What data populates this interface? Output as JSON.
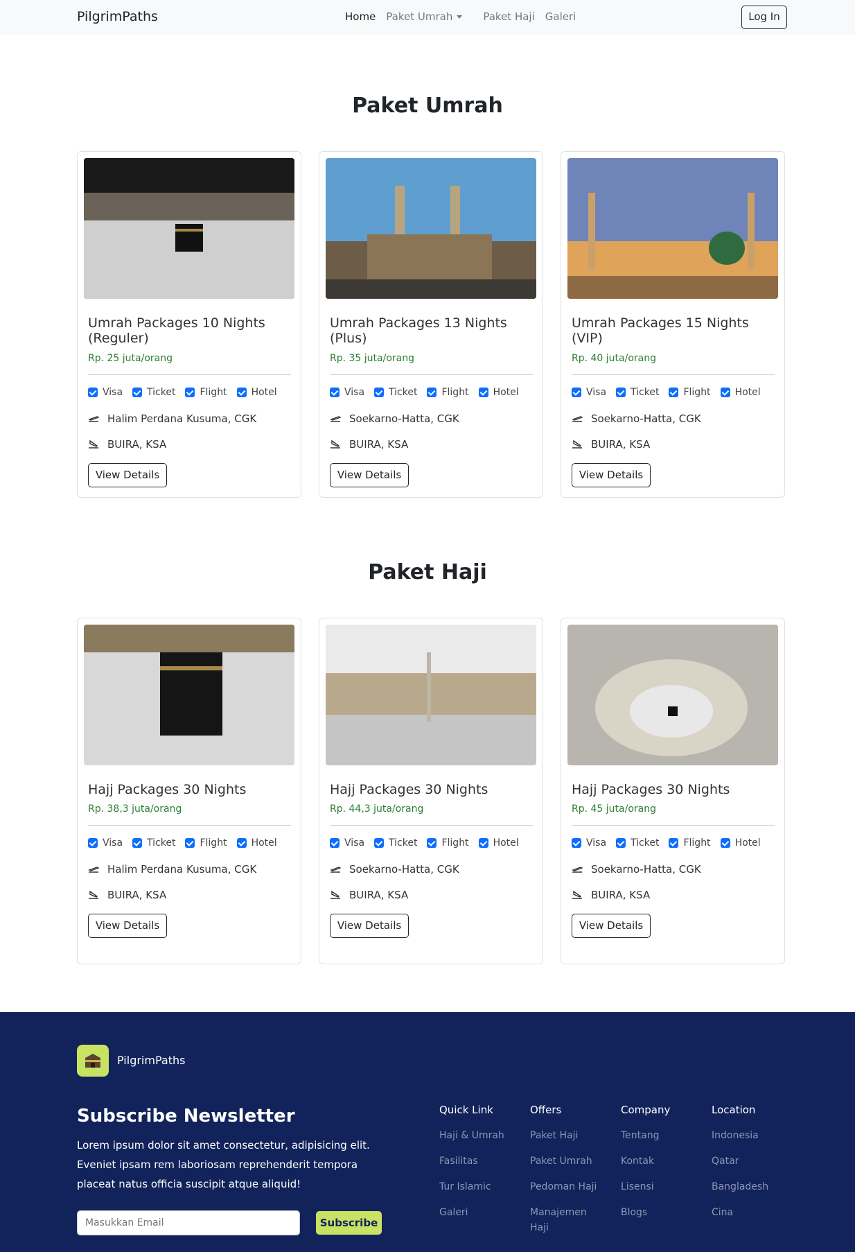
{
  "navbar": {
    "brand": "PilgrimPaths",
    "links": [
      "Home",
      "Paket Umrah",
      "Paket Haji",
      "Galeri"
    ],
    "login": "Log In"
  },
  "umrah": {
    "title": "Paket Umrah",
    "cards": [
      {
        "title": "Umrah Packages 10 Nights (Reguler)",
        "price": "Rp. 25 juta/orang",
        "features": [
          "Visa",
          "Ticket",
          "Flight",
          "Hotel"
        ],
        "depart": "Halim Perdana Kusuma, CGK",
        "arrive": "BUIRA, KSA",
        "button": "View Details"
      },
      {
        "title": "Umrah Packages 13 Nights (Plus)",
        "price": "Rp. 35 juta/orang",
        "features": [
          "Visa",
          "Ticket",
          "Flight",
          "Hotel"
        ],
        "depart": "Soekarno-Hatta, CGK",
        "arrive": "BUIRA, KSA",
        "button": "View Details"
      },
      {
        "title": "Umrah Packages 15 Nights (VIP)",
        "price": "Rp. 40 juta/orang",
        "features": [
          "Visa",
          "Ticket",
          "Flight",
          "Hotel"
        ],
        "depart": "Soekarno-Hatta, CGK",
        "arrive": "BUIRA, KSA",
        "button": "View Details"
      }
    ]
  },
  "haji": {
    "title": "Paket Haji",
    "cards": [
      {
        "title": "Hajj Packages 30 Nights",
        "price": "Rp. 38,3 juta/orang",
        "features": [
          "Visa",
          "Ticket",
          "Flight",
          "Hotel"
        ],
        "depart": "Halim Perdana Kusuma, CGK",
        "arrive": "BUIRA, KSA",
        "button": "View Details"
      },
      {
        "title": "Hajj Packages 30 Nights",
        "price": "Rp. 44,3 juta/orang",
        "features": [
          "Visa",
          "Ticket",
          "Flight",
          "Hotel"
        ],
        "depart": "Soekarno-Hatta, CGK",
        "arrive": "BUIRA, KSA",
        "button": "View Details"
      },
      {
        "title": "Hajj Packages 30 Nights",
        "price": "Rp. 45 juta/orang",
        "features": [
          "Visa",
          "Ticket",
          "Flight",
          "Hotel"
        ],
        "depart": "Soekarno-Hatta, CGK",
        "arrive": "BUIRA, KSA",
        "button": "View Details"
      }
    ]
  },
  "footer": {
    "brand": "PilgrimPaths",
    "newsletter_title": "Subscribe Newsletter",
    "newsletter_text": "Lorem ipsum dolor sit amet consectetur, adipisicing elit. Eveniet ipsam rem laboriosam reprehenderit tempora placeat natus officia suscipit atque aliquid!",
    "email_placeholder": "Masukkan Email",
    "subscribe": "Subscribe",
    "columns": [
      {
        "title": "Quick Link",
        "links": [
          "Haji & Umrah",
          "Fasilitas",
          "Tur Islamic",
          "Galeri"
        ]
      },
      {
        "title": "Offers",
        "links": [
          "Paket Haji",
          "Paket Umrah",
          "Pedoman Haji",
          "Manajemen Haji"
        ]
      },
      {
        "title": "Company",
        "links": [
          "Tentang",
          "Kontak",
          "Lisensi",
          "Blogs"
        ]
      },
      {
        "title": "Location",
        "links": [
          "Indonesia",
          "Qatar",
          "Bangladesh",
          "Cina"
        ]
      }
    ]
  },
  "colors": {
    "navbar_bg": "#f8f9fa",
    "price": "#2e7d32",
    "checkbox": "#0d6efd",
    "footer_bg": "#11235a",
    "accent": "#c8e264"
  }
}
